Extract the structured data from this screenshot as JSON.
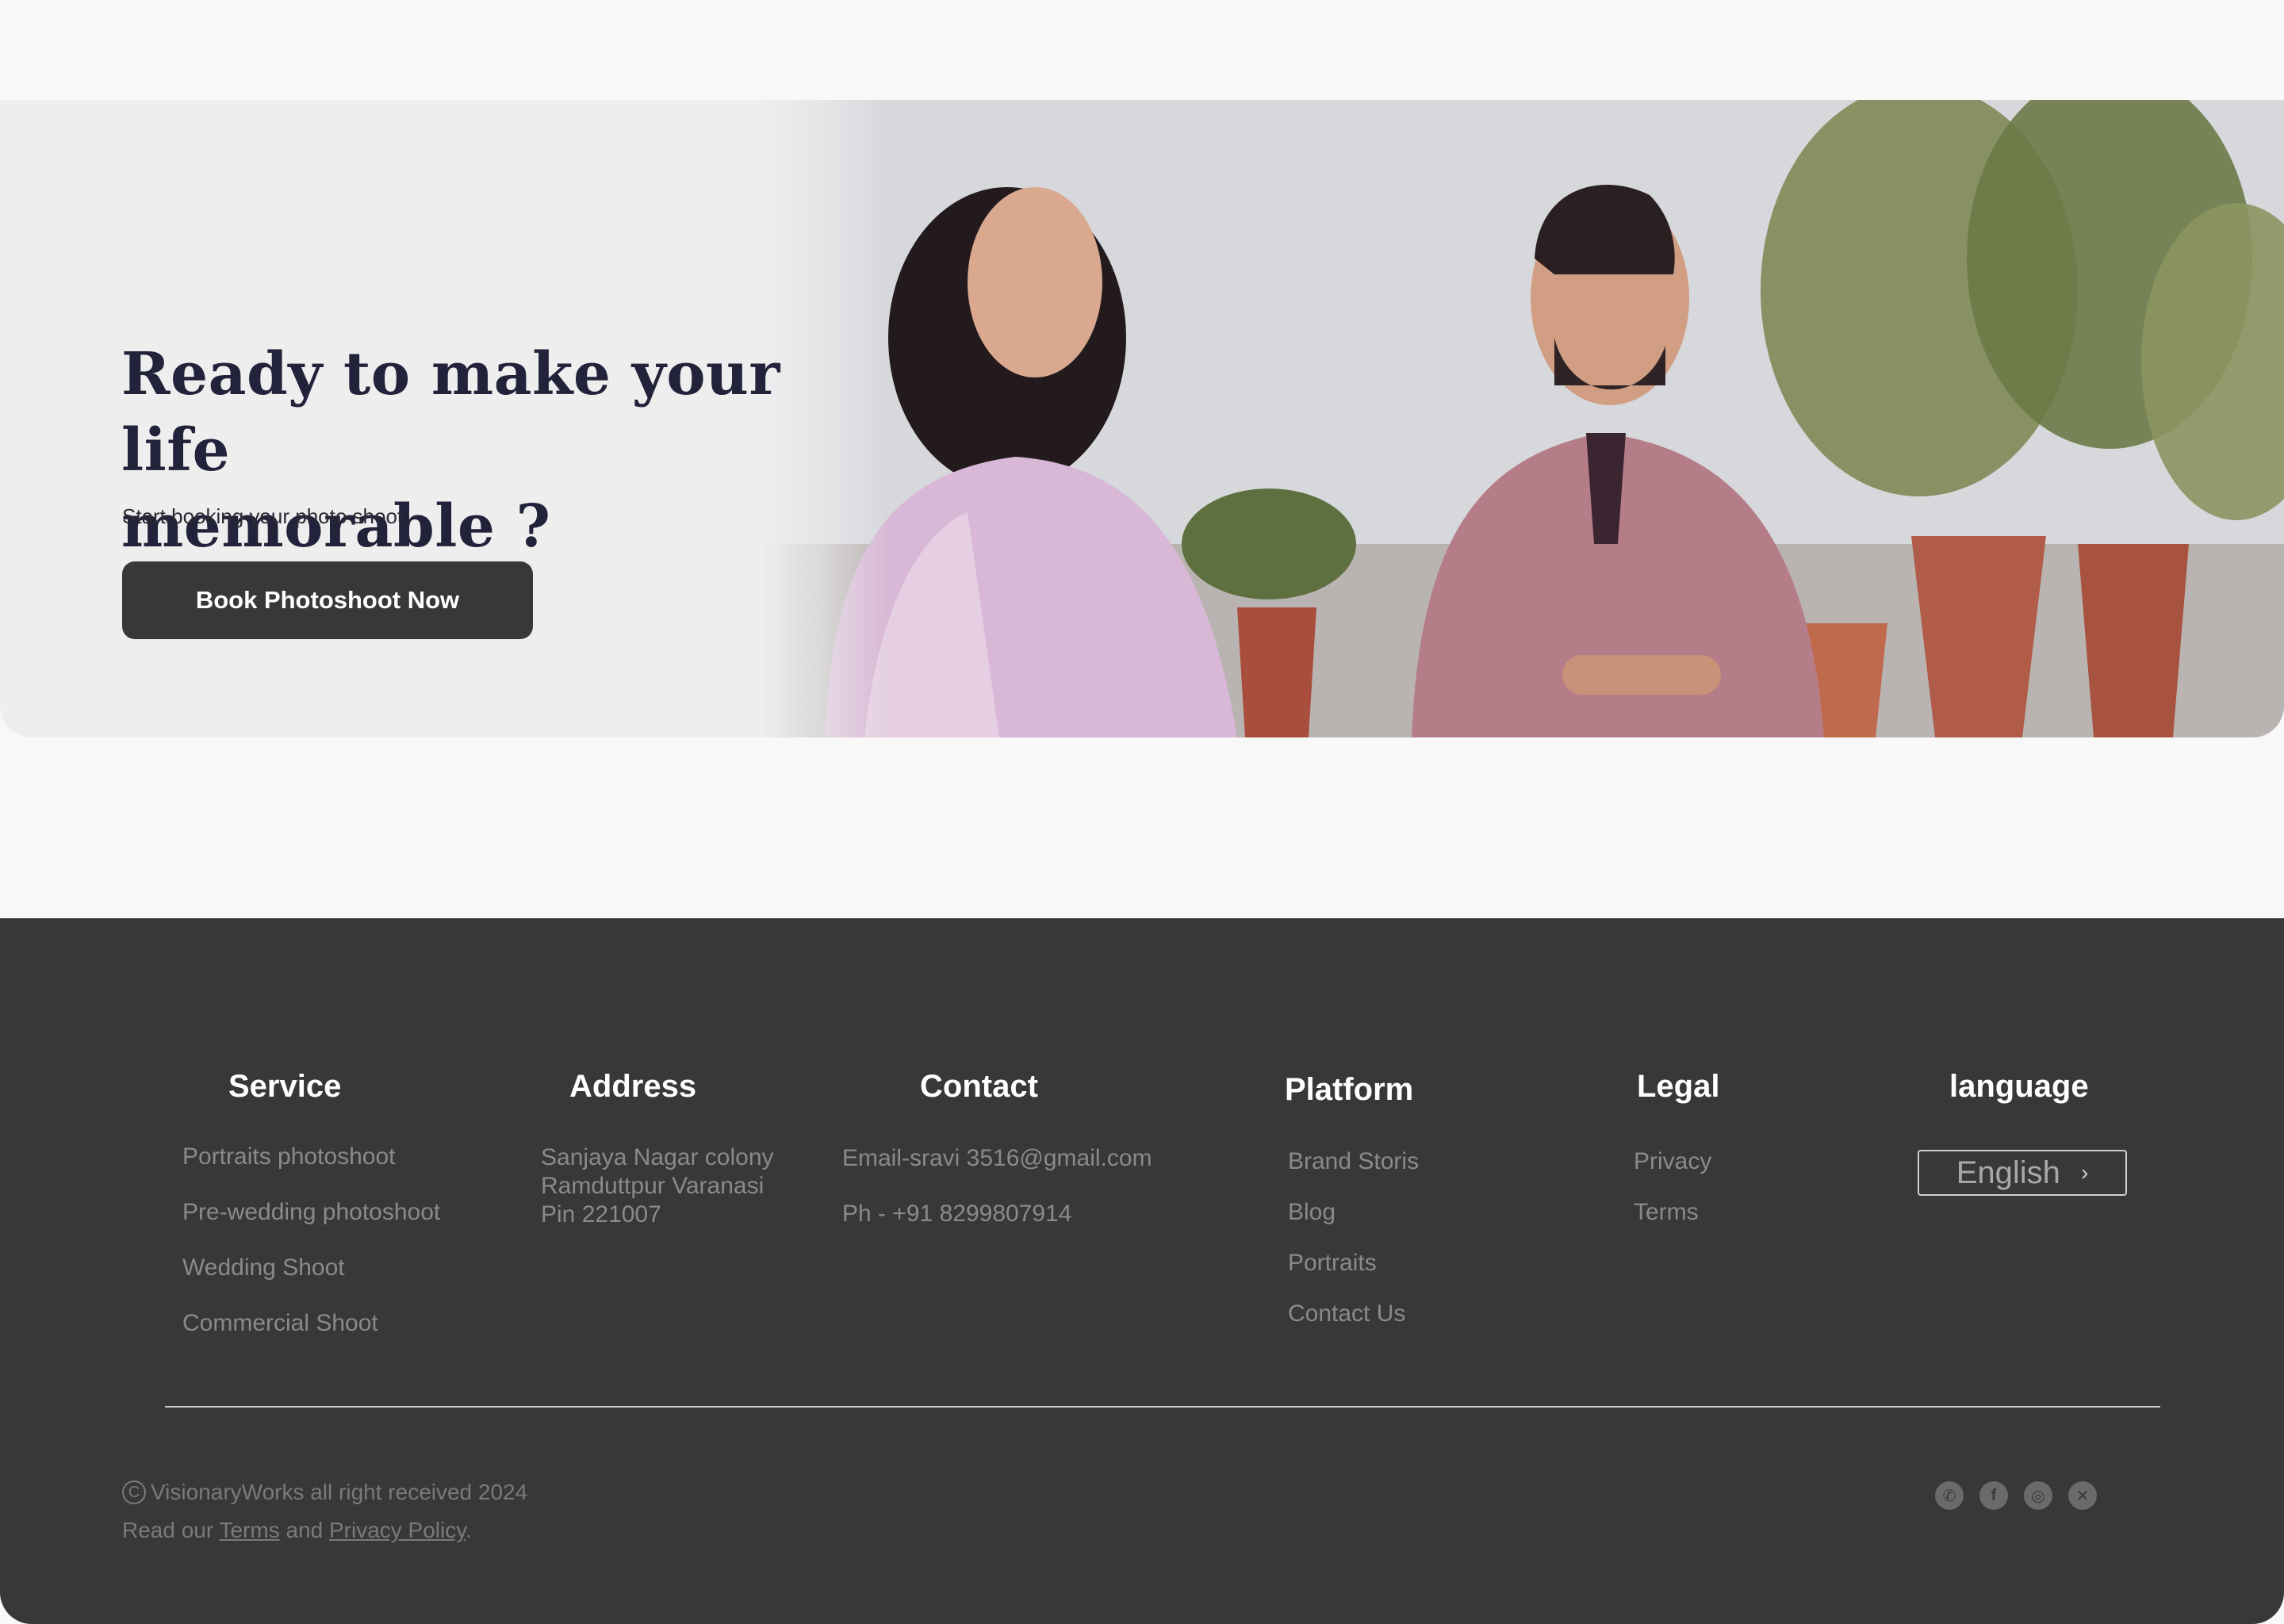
{
  "cta": {
    "heading_line1": "Ready to make your life",
    "heading_line2": "memorable ?",
    "subtitle": "Start booking your photo shoot",
    "button_label": "Book Photoshoot Now"
  },
  "footer": {
    "service": {
      "title": "Service",
      "items": [
        "Portraits photoshoot",
        "Pre-wedding photoshoot",
        "Wedding Shoot",
        "Commercial Shoot"
      ]
    },
    "address": {
      "title": "Address",
      "lines": [
        "Sanjaya Nagar colony",
        "Ramduttpur Varanasi",
        "Pin 221007"
      ]
    },
    "contact": {
      "title": "Contact",
      "email": "Email-sravi 3516@gmail.com",
      "phone": "Ph - +91 8299807914"
    },
    "platform": {
      "title": "Platform",
      "items": [
        "Brand Storis",
        "Blog",
        "Portraits",
        "Contact Us"
      ]
    },
    "legal": {
      "title": "Legal",
      "items": [
        "Privacy",
        "Terms"
      ]
    },
    "language": {
      "title": "language",
      "selected": "English"
    },
    "copyright": "VisionaryWorks all right received 2024",
    "legal_note": {
      "prefix": "Read our ",
      "terms_link": "Terms",
      "middle": " and ",
      "privacy_link": "Privacy Policy",
      "suffix": "."
    },
    "social_icons": [
      "whatsapp-icon",
      "facebook-icon",
      "instagram-icon",
      "x-twitter-icon"
    ]
  },
  "colors": {
    "page_bg": "#f8f8f8",
    "footer_bg": "#383838",
    "button_bg": "#383838",
    "heading_text": "#22223a",
    "muted_text": "#8a8a8a"
  }
}
